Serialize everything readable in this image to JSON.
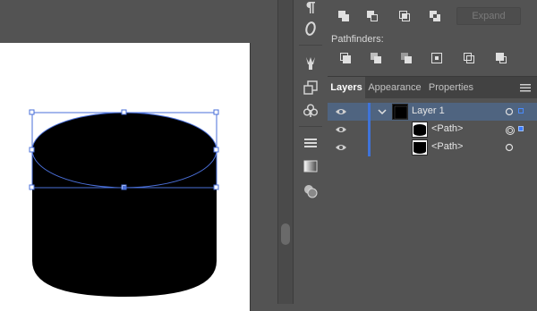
{
  "pathfinder": {
    "expand_label": "Expand",
    "section_label": "Pathfinders:",
    "shape_modes": [
      "unite-icon",
      "minus-front-icon",
      "intersect-icon",
      "exclude-icon"
    ],
    "pathfinders": [
      "divide-icon",
      "trim-icon",
      "merge-icon",
      "crop-icon",
      "outline-icon",
      "minus-back-icon"
    ]
  },
  "tabs": {
    "layers": "Layers",
    "appearance": "Appearance",
    "properties": "Properties",
    "active": "Layers"
  },
  "layers": [
    {
      "name": "Layer 1",
      "expanded": true,
      "selected": true
    },
    {
      "name": "<Path>",
      "selected": true
    },
    {
      "name": "<Path>",
      "selected": false
    }
  ],
  "tools": [
    "paragraph-icon",
    "opentype-icon",
    "brush-library-icon",
    "transform-icon",
    "symbols-icon",
    "align-icon",
    "gradient-icon",
    "transparency-icon"
  ],
  "colors": {
    "panel_bg": "#535353",
    "selection_blue": "#3f73d9",
    "row_selected_bg": "#4f6480",
    "artboard": "#ffffff",
    "shape_fill": "#000000"
  }
}
